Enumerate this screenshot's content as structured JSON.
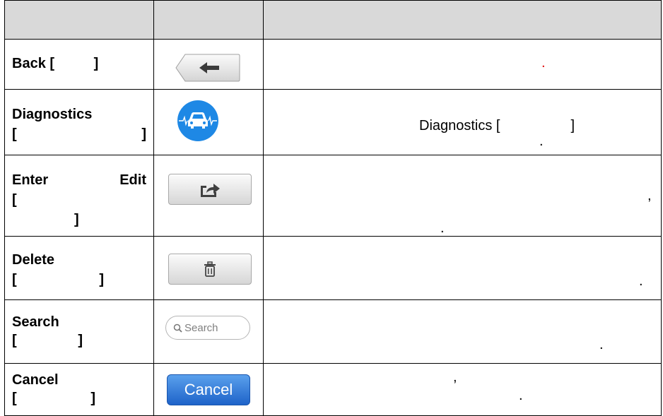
{
  "rows": [
    {
      "label": "Back [          ]",
      "icon": "back-arrow-icon"
    },
    {
      "label_line1": "Diagnostics",
      "label_line2_left": "[",
      "label_line2_right": "]",
      "icon": "diagnostics-car-icon",
      "desc_line1": "Diagnostics [                  ]",
      "desc_line2": "."
    },
    {
      "label_line1_left": "Enter",
      "label_line1_right": "Edit",
      "label_line2": "[",
      "label_line3": "]",
      "icon": "share-export-icon",
      "desc_comma": ",",
      "desc_period": "."
    },
    {
      "label_line1": "Delete",
      "label_line2_left": "[",
      "label_line2_right": "]",
      "icon": "trash-icon",
      "desc_period": "."
    },
    {
      "label_line1": "Search",
      "label_line2_left": "[",
      "label_line2_right": "]",
      "search_placeholder": "Search",
      "icon": "search-icon",
      "desc_period": "."
    },
    {
      "label_line1": "Cancel",
      "label_line2_left": "[",
      "label_line2_right": "]",
      "cancel_label": "Cancel",
      "desc_comma": ",",
      "desc_period": "."
    }
  ],
  "back_desc_mark": ".",
  "colors": {
    "header_bg": "#d9d9d9",
    "diag_blue": "#1e88e5",
    "cancel_blue": "#2f78d8",
    "red_mark": "#e00000"
  }
}
